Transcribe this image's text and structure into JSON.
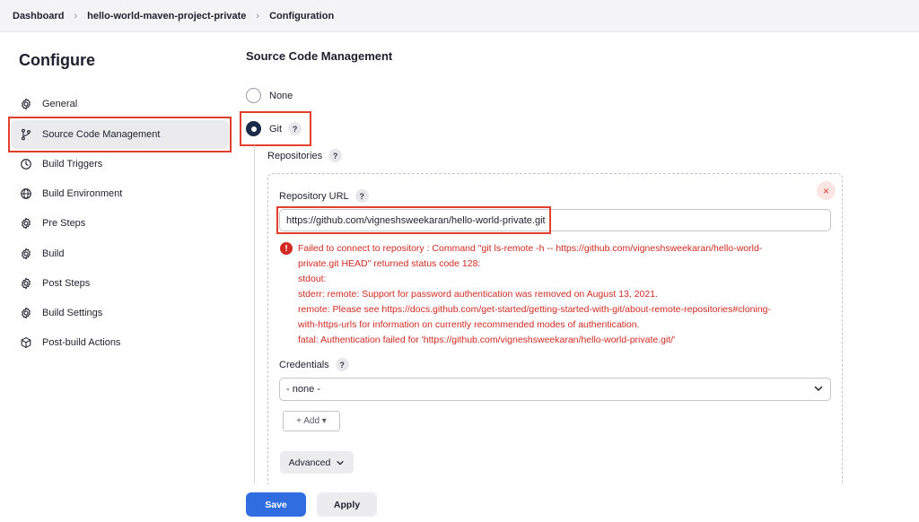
{
  "breadcrumb": [
    "Dashboard",
    "hello-world-maven-project-private",
    "Configuration"
  ],
  "sidebar": {
    "title": "Configure",
    "items": [
      {
        "label": "General",
        "icon": "gear-icon"
      },
      {
        "label": "Source Code Management",
        "icon": "branch-icon",
        "active": true
      },
      {
        "label": "Build Triggers",
        "icon": "clock-icon"
      },
      {
        "label": "Build Environment",
        "icon": "globe-icon"
      },
      {
        "label": "Pre Steps",
        "icon": "gear-icon"
      },
      {
        "label": "Build",
        "icon": "gear-icon"
      },
      {
        "label": "Post Steps",
        "icon": "gear-icon"
      },
      {
        "label": "Build Settings",
        "icon": "gear-icon"
      },
      {
        "label": "Post-build Actions",
        "icon": "cube-icon"
      }
    ]
  },
  "main": {
    "section_title": "Source Code Management",
    "scm_none_label": "None",
    "scm_git_label": "Git",
    "help_glyph": "?",
    "repositories_label": "Repositories",
    "repo_url_label": "Repository URL",
    "repo_url_value": "https://github.com/vigneshsweekaran/hello-world-private.git",
    "error_lines": [
      "Failed to connect to repository : Command \"git ls-remote -h -- https://github.com/vigneshsweekaran/hello-world-",
      "private.git HEAD\" returned status code 128:",
      "stdout:",
      "stderr: remote: Support for password authentication was removed on August 13, 2021.",
      "remote: Please see https://docs.github.com/get-started/getting-started-with-git/about-remote-repositories#cloning-",
      "with-https-urls for information on currently recommended modes of authentication.",
      "fatal: Authentication failed for 'https://github.com/vigneshsweekaran/hello-world-private.git/'"
    ],
    "error_icon_glyph": "!",
    "credentials_label": "Credentials",
    "credentials_value": "- none -",
    "add_button_label": "+ Add ▾",
    "advanced_button_label": "Advanced",
    "close_glyph": "×"
  },
  "footer": {
    "save_label": "Save",
    "apply_label": "Apply"
  },
  "colors": {
    "accent": "#2f6de1",
    "error": "#d22a22",
    "highlight": "#e0402c"
  }
}
